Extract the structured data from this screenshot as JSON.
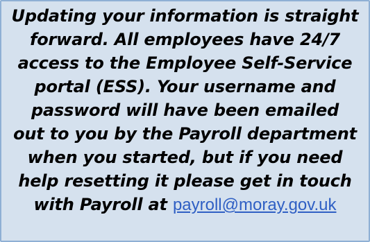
{
  "callout": {
    "lines": [
      "Updating your information is straight",
      "forward. All employees have 24/7",
      "access to the Employee Self-Service",
      "portal (ESS). Your username and",
      "password will have been emailed",
      "out to you by the Payroll department",
      "when you started, but if you need",
      "help resetting it please get in touch"
    ],
    "last_line_prefix": "with Payroll at",
    "email_link": "payroll@moray.gov.uk",
    "colors": {
      "background": "#d5e1ee",
      "border": "#8fb0d4",
      "link": "#2f5fc4"
    }
  }
}
